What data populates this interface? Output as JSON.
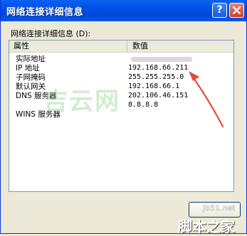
{
  "window": {
    "title": "网络连接详细信息",
    "help_label": "?"
  },
  "details_label": "网络连接详细信息 (D):",
  "columns": {
    "property": "属性",
    "value": "数值"
  },
  "rows": [
    {
      "property": "实际地址",
      "value": ""
    },
    {
      "property": "IP 地址",
      "value": "192.168.66.211"
    },
    {
      "property": "子网掩码",
      "value": "255.255.255.0"
    },
    {
      "property": "默认网关",
      "value": "192.168.66.1"
    },
    {
      "property": "DNS 服务器",
      "value": "202.106.46.151"
    },
    {
      "property": "",
      "value": "8.8.8.8"
    },
    {
      "property": "WINS 服务器",
      "value": ""
    }
  ],
  "watermark": {
    "main": "吉云网",
    "sub": ""
  },
  "site": {
    "domain": "jb51.net",
    "name": "脚本之家"
  },
  "colors": {
    "titlebar": "#0050e6",
    "arrow": "#e84a3c",
    "window_bg": "#ece9d8"
  },
  "icons": [
    "help-icon",
    "close-icon",
    "arrow-annotation"
  ]
}
